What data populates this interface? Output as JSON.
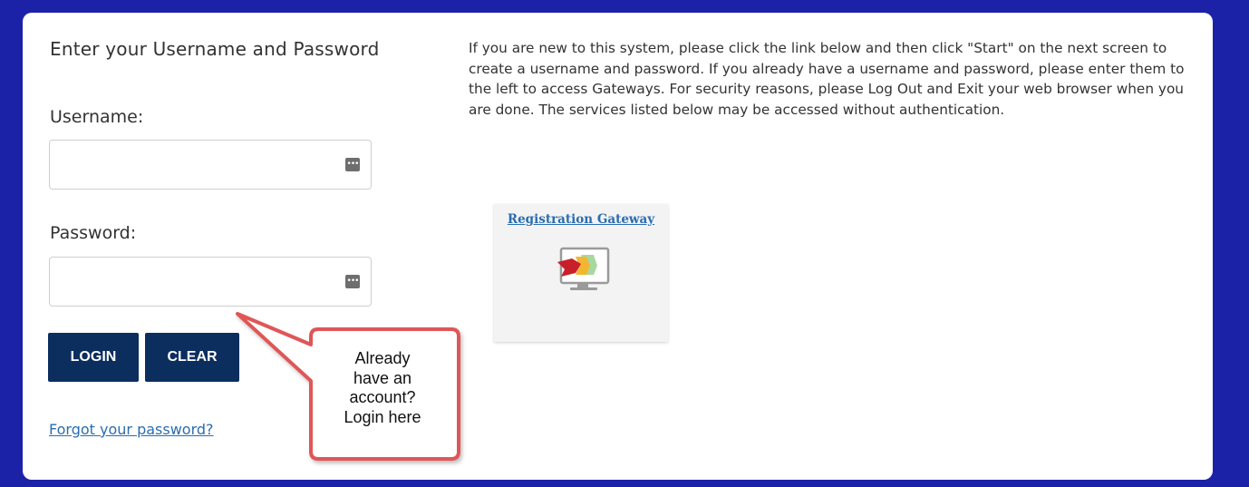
{
  "login": {
    "heading": "Enter your Username and Password",
    "username_label": "Username:",
    "username_value": "",
    "password_label": "Password:",
    "password_value": "",
    "login_button": "LOGIN",
    "clear_button": "CLEAR",
    "forgot_link": "Forgot your password?"
  },
  "info": {
    "text": "If you are new to this system, please click the link below and then click \"Start\" on the next screen to create a username and password. If you already have a username and password, please enter them to the left to access Gateways. For security reasons, please Log Out and Exit your web browser when you are done.  The services listed below may be accessed without authentication."
  },
  "gateway_tile": {
    "title": "Registration Gateway",
    "icon": "monitor-with-colored-arrows-icon"
  },
  "callout": {
    "lines": [
      "Already",
      "have an",
      "account?",
      "Login here"
    ]
  },
  "colors": {
    "page_background": "#1c22a8",
    "button_background": "#0b2e5e",
    "link": "#2a6db0",
    "callout_border": "#e05656"
  }
}
